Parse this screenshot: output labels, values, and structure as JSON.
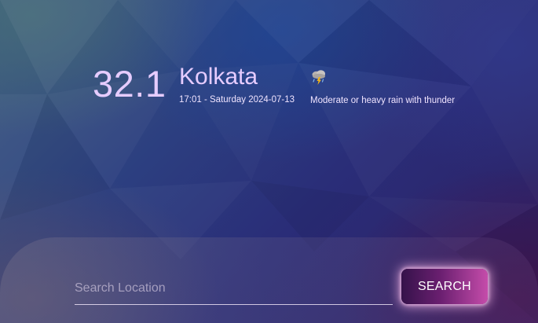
{
  "weather": {
    "temperature": "32.1",
    "city": "Kolkata",
    "datetime": "17:01 - Saturday 2024-07-13",
    "condition": "Moderate or heavy rain with thunder",
    "icon": "thunderstorm-rain-icon"
  },
  "search": {
    "placeholder": "Search Location",
    "value": "",
    "button_label": "SEARCH"
  },
  "colors": {
    "text_accent": "#e6ccff",
    "button_start": "#35124a",
    "button_end": "#c54caa"
  }
}
